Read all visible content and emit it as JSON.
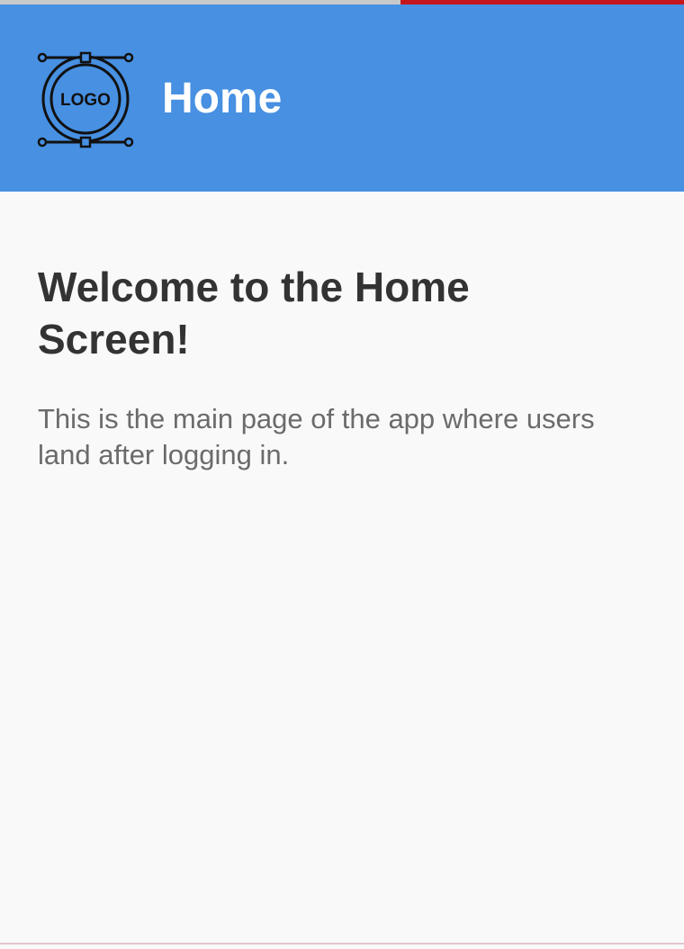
{
  "header": {
    "title": "Home",
    "logo_icon": "logo-icon",
    "logo_text": "LOGO",
    "background_color": "#4790e2"
  },
  "main": {
    "heading": "Welcome to the Home Screen!",
    "description": "This is the main page of the app where users land after logging in."
  },
  "colors": {
    "status_accent": "#c4161c",
    "heading_text": "#333333",
    "body_text": "#6b6b6b",
    "page_background": "#f9f9f9"
  }
}
